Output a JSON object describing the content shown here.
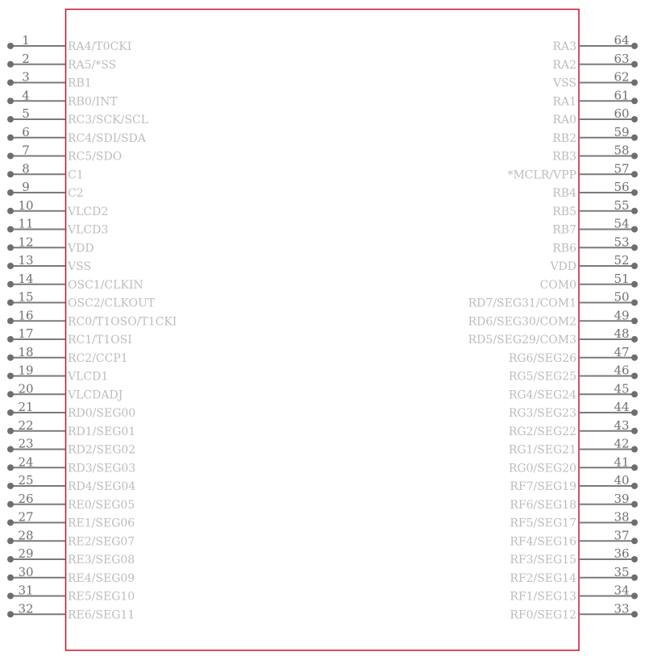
{
  "component": {
    "outline_color": "#c8102e",
    "pin_color": "#707070",
    "label_color": "#bdbdbd",
    "left_pins": [
      {
        "number": "1",
        "name": "RA4/T0CKI"
      },
      {
        "number": "2",
        "name": "RA5/*SS"
      },
      {
        "number": "3",
        "name": "RB1"
      },
      {
        "number": "4",
        "name": "RB0/INT"
      },
      {
        "number": "5",
        "name": "RC3/SCK/SCL"
      },
      {
        "number": "6",
        "name": "RC4/SDI/SDA"
      },
      {
        "number": "7",
        "name": "RC5/SDO"
      },
      {
        "number": "8",
        "name": "C1"
      },
      {
        "number": "9",
        "name": "C2"
      },
      {
        "number": "10",
        "name": "VLCD2"
      },
      {
        "number": "11",
        "name": "VLCD3"
      },
      {
        "number": "12",
        "name": "VDD"
      },
      {
        "number": "13",
        "name": "VSS"
      },
      {
        "number": "14",
        "name": "OSC1/CLKIN"
      },
      {
        "number": "15",
        "name": "OSC2/CLKOUT"
      },
      {
        "number": "16",
        "name": "RC0/T1OSO/T1CKI"
      },
      {
        "number": "17",
        "name": "RC1/T1OSI"
      },
      {
        "number": "18",
        "name": "RC2/CCP1"
      },
      {
        "number": "19",
        "name": "VLCD1"
      },
      {
        "number": "20",
        "name": "VLCDADJ"
      },
      {
        "number": "21",
        "name": "RD0/SEG00"
      },
      {
        "number": "22",
        "name": "RD1/SEG01"
      },
      {
        "number": "23",
        "name": "RD2/SEG02"
      },
      {
        "number": "24",
        "name": "RD3/SEG03"
      },
      {
        "number": "25",
        "name": "RD4/SEG04"
      },
      {
        "number": "26",
        "name": "RE0/SEG05"
      },
      {
        "number": "27",
        "name": "RE1/SEG06"
      },
      {
        "number": "28",
        "name": "RE2/SEG07"
      },
      {
        "number": "29",
        "name": "RE3/SEG08"
      },
      {
        "number": "30",
        "name": "RE4/SEG09"
      },
      {
        "number": "31",
        "name": "RE5/SEG10"
      },
      {
        "number": "32",
        "name": "RE6/SEG11"
      }
    ],
    "right_pins": [
      {
        "number": "64",
        "name": "RA3"
      },
      {
        "number": "63",
        "name": "RA2"
      },
      {
        "number": "62",
        "name": "VSS"
      },
      {
        "number": "61",
        "name": "RA1"
      },
      {
        "number": "60",
        "name": "RA0"
      },
      {
        "number": "59",
        "name": "RB2"
      },
      {
        "number": "58",
        "name": "RB3"
      },
      {
        "number": "57",
        "name": "*MCLR/VPP"
      },
      {
        "number": "56",
        "name": "RB4"
      },
      {
        "number": "55",
        "name": "RB5"
      },
      {
        "number": "54",
        "name": "RB7"
      },
      {
        "number": "53",
        "name": "RB6"
      },
      {
        "number": "52",
        "name": "VDD"
      },
      {
        "number": "51",
        "name": "COM0"
      },
      {
        "number": "50",
        "name": "RD7/SEG31/COM1"
      },
      {
        "number": "49",
        "name": "RD6/SEG30/COM2"
      },
      {
        "number": "48",
        "name": "RD5/SEG29/COM3"
      },
      {
        "number": "47",
        "name": "RG6/SEG26"
      },
      {
        "number": "46",
        "name": "RG5/SEG25"
      },
      {
        "number": "45",
        "name": "RG4/SEG24"
      },
      {
        "number": "44",
        "name": "RG3/SEG23"
      },
      {
        "number": "43",
        "name": "RG2/SEG22"
      },
      {
        "number": "42",
        "name": "RG1/SEG21"
      },
      {
        "number": "41",
        "name": "RG0/SEG20"
      },
      {
        "number": "40",
        "name": "RF7/SEG19"
      },
      {
        "number": "39",
        "name": "RF6/SEG18"
      },
      {
        "number": "38",
        "name": "RF5/SEG17"
      },
      {
        "number": "37",
        "name": "RF4/SEG16"
      },
      {
        "number": "36",
        "name": "RF3/SEG15"
      },
      {
        "number": "35",
        "name": "RF2/SEG14"
      },
      {
        "number": "34",
        "name": "RF1/SEG13"
      },
      {
        "number": "33",
        "name": "RF0/SEG12"
      }
    ]
  }
}
